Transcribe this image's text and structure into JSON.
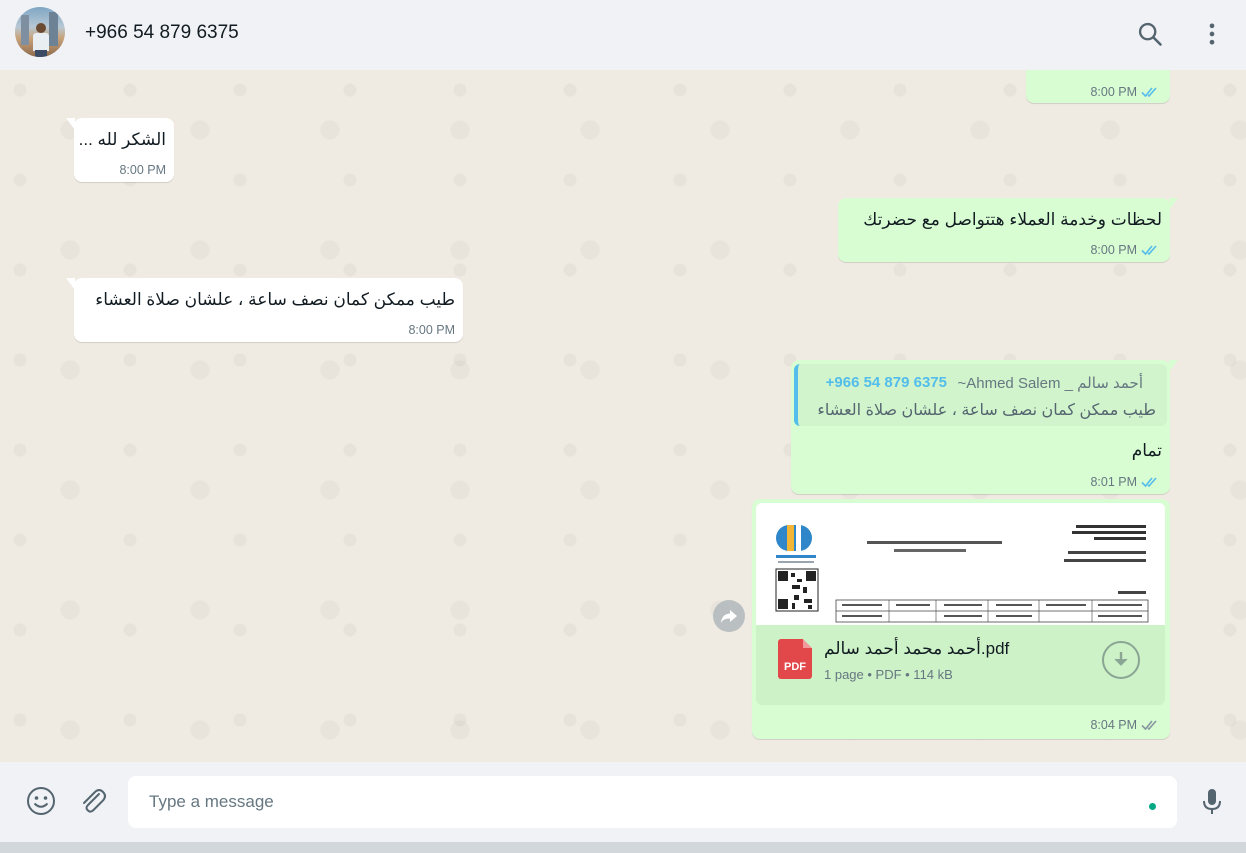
{
  "header": {
    "contact_name": "+966 54 879 6375",
    "icons": [
      "search-icon",
      "menu-icon"
    ]
  },
  "messages": [
    {
      "direction": "out",
      "text": "",
      "time": "8:00 PM",
      "status": "read"
    },
    {
      "direction": "in",
      "text": "الشكر لله ...",
      "time": "8:00 PM"
    },
    {
      "direction": "out",
      "text": "لحظات وخدمة العملاء هتتواصل مع حضرتك",
      "time": "8:00 PM",
      "status": "read"
    },
    {
      "direction": "in",
      "text": "طيب ممكن كمان نصف ساعة ، علشان صلاة العشاء",
      "time": "8:00 PM"
    },
    {
      "direction": "out",
      "text": "تمام",
      "time": "8:01 PM",
      "status": "read",
      "quote": {
        "phone": "+966 54 879 6375",
        "author": "~Ahmed Salem _ أحمد سالم",
        "text": "طيب ممكن كمان نصف ساعة ، علشان صلاة العشاء"
      }
    },
    {
      "direction": "out",
      "time": "8:04 PM",
      "status": "delivered",
      "document": {
        "name": "أحمد محمد أحمد سالم.pdf",
        "info": "1 page • PDF • 114 kB",
        "icon_label": "PDF"
      }
    }
  ],
  "colors": {
    "incoming": "#ffffff",
    "outgoing": "#d9fdd3",
    "read_ticks": "#53bdeb",
    "accent": "#00a884"
  },
  "composer": {
    "placeholder": "Type a message"
  }
}
